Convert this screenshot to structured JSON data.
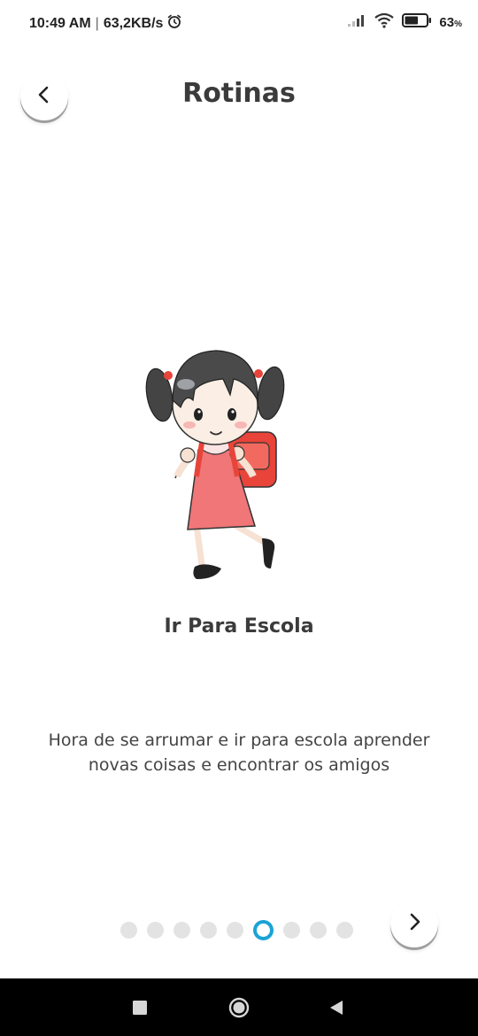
{
  "status_bar": {
    "time": "10:49 AM",
    "separator": "|",
    "speed": "63,2KB/s",
    "battery_percent": "63",
    "battery_unit": "%",
    "battery_level": 0.63,
    "icons": [
      "alarm-icon",
      "signal-icon",
      "wifi-icon",
      "battery-icon"
    ]
  },
  "header": {
    "title": "Rotinas",
    "back_icon": "chevron-left-icon"
  },
  "routine": {
    "illustration": "girl-with-backpack",
    "title": "Ir Para Escola",
    "description": "Hora de se arrumar e ir para escola aprender novas coisas e encontrar os amigos"
  },
  "pager": {
    "total": 9,
    "active_index": 5,
    "active_color": "#1ba3d6",
    "inactive_color": "#e3e3e3",
    "next_icon": "chevron-right-icon"
  },
  "nav_bar": {
    "buttons": [
      "recents-icon",
      "home-icon",
      "back-triangle-icon"
    ]
  }
}
